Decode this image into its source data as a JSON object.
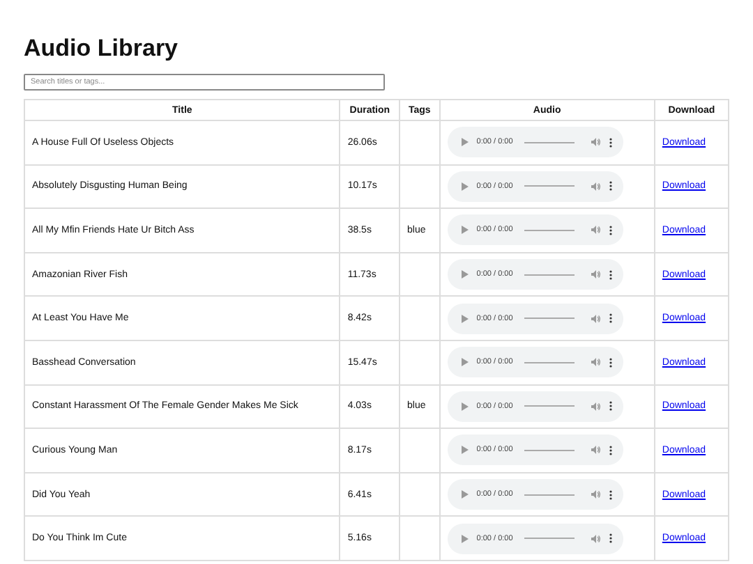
{
  "title": "Audio Library",
  "search": {
    "placeholder": "Search titles or tags..."
  },
  "table": {
    "columns": [
      "Title",
      "Duration",
      "Tags",
      "Audio",
      "Download"
    ],
    "rows": [
      {
        "title": "A House Full Of Useless Objects",
        "duration": "26.06s",
        "tags": "",
        "time": "0:00 / 0:00",
        "download": "Download"
      },
      {
        "title": "Absolutely Disgusting Human Being",
        "duration": "10.17s",
        "tags": "",
        "time": "0:00 / 0:00",
        "download": "Download"
      },
      {
        "title": "All My Mfin Friends Hate Ur Bitch Ass",
        "duration": "38.5s",
        "tags": "blue",
        "time": "0:00 / 0:00",
        "download": "Download"
      },
      {
        "title": "Amazonian River Fish",
        "duration": "11.73s",
        "tags": "",
        "time": "0:00 / 0:00",
        "download": "Download"
      },
      {
        "title": "At Least You Have Me",
        "duration": "8.42s",
        "tags": "",
        "time": "0:00 / 0:00",
        "download": "Download"
      },
      {
        "title": "Basshead Conversation",
        "duration": "15.47s",
        "tags": "",
        "time": "0:00 / 0:00",
        "download": "Download"
      },
      {
        "title": "Constant Harassment Of The Female Gender Makes Me Sick",
        "duration": "4.03s",
        "tags": "blue",
        "time": "0:00 / 0:00",
        "download": "Download"
      },
      {
        "title": "Curious Young Man",
        "duration": "8.17s",
        "tags": "",
        "time": "0:00 / 0:00",
        "download": "Download"
      },
      {
        "title": "Did You Yeah",
        "duration": "6.41s",
        "tags": "",
        "time": "0:00 / 0:00",
        "download": "Download"
      },
      {
        "title": "Do You Think Im Cute",
        "duration": "5.16s",
        "tags": "",
        "time": "0:00 / 0:00",
        "download": "Download"
      }
    ]
  }
}
